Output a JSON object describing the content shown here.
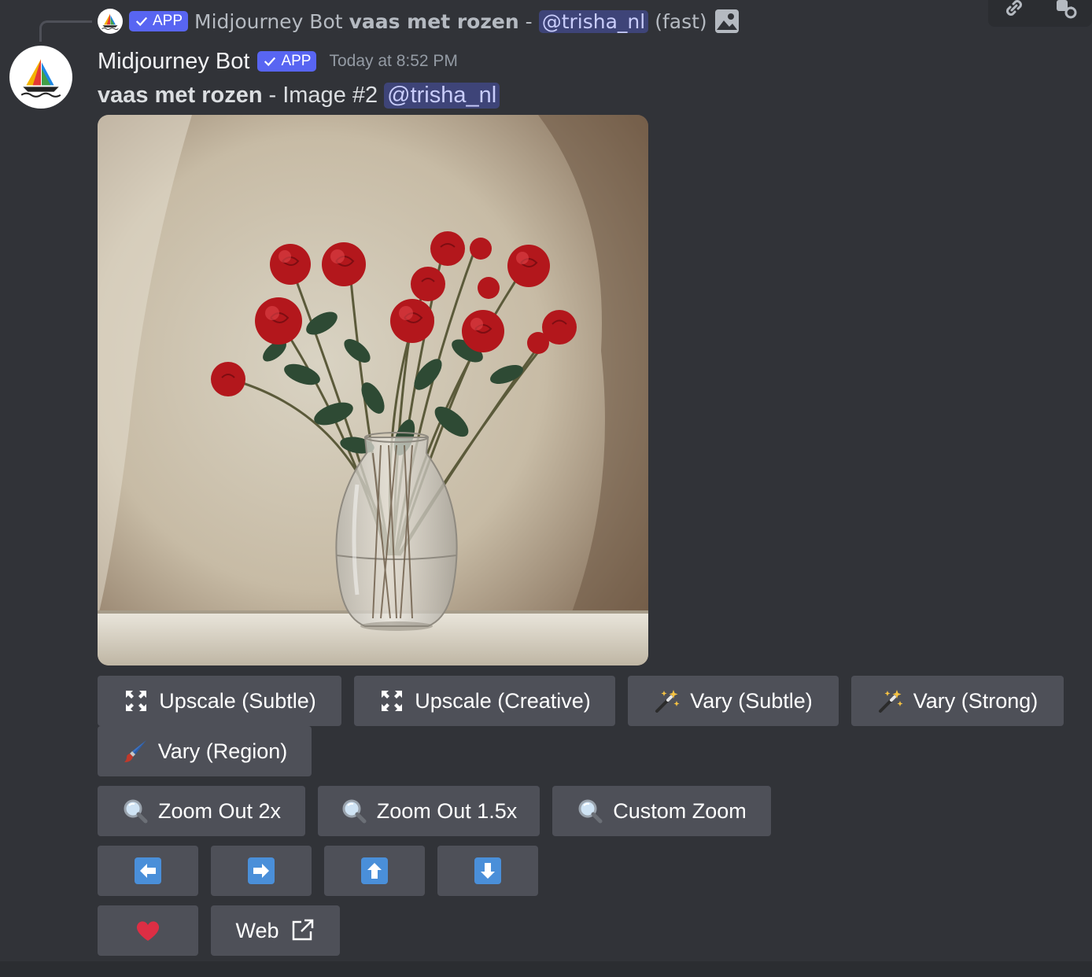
{
  "reply": {
    "bot_name": "Midjourney Bot",
    "badge": "APP",
    "prompt": "vaas met rozen",
    "separator": "-",
    "mention": "@trisha_nl",
    "speed": "(fast)"
  },
  "message": {
    "author": "Midjourney Bot",
    "badge": "APP",
    "timestamp": "Today at 8:52 PM",
    "prompt": "vaas met rozen",
    "separator": "-",
    "image_label": "Image #2",
    "mention": "@trisha_nl"
  },
  "buttons": {
    "upscale_subtle": "Upscale (Subtle)",
    "upscale_creative": "Upscale (Creative)",
    "vary_subtle": "Vary (Subtle)",
    "vary_strong": "Vary (Strong)",
    "vary_region": "Vary (Region)",
    "zoom_out_2x": "Zoom Out 2x",
    "zoom_out_1_5x": "Zoom Out 1.5x",
    "custom_zoom": "Custom Zoom",
    "web": "Web"
  },
  "icons": {
    "upscale": "expand-arrows-icon",
    "vary": "magic-wand-icon",
    "region": "paintbrush-icon",
    "zoom": "magnifier-icon",
    "pan_left": "arrow-left-icon",
    "pan_right": "arrow-right-icon",
    "pan_up": "arrow-up-icon",
    "pan_down": "arrow-down-icon",
    "favorite": "heart-icon",
    "external": "external-link-icon"
  },
  "colors": {
    "background": "#313338",
    "button": "#4e5058",
    "badge": "#5865f2",
    "mention_bg": "#3c4270",
    "arrow_blue": "#4a8fd9",
    "heart": "#dd2e44"
  }
}
